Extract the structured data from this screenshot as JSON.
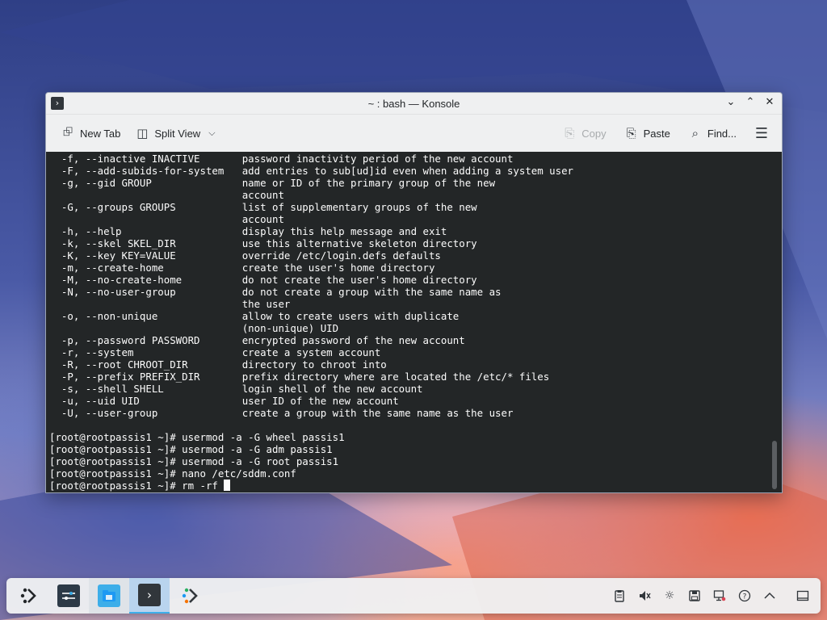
{
  "window": {
    "title": "~ : bash — Konsole",
    "controls": {
      "minimize_icon": "chevron-down-icon",
      "maximize_icon": "chevron-up-icon",
      "close_icon": "close-icon"
    }
  },
  "toolbar": {
    "new_tab": "New Tab",
    "split_view": "Split View",
    "copy": "Copy",
    "paste": "Paste",
    "find": "Find..."
  },
  "terminal": {
    "lines": [
      "  -f, --inactive INACTIVE       password inactivity period of the new account",
      "  -F, --add-subids-for-system   add entries to sub[ud]id even when adding a system user",
      "  -g, --gid GROUP               name or ID of the primary group of the new",
      "                                account",
      "  -G, --groups GROUPS           list of supplementary groups of the new",
      "                                account",
      "  -h, --help                    display this help message and exit",
      "  -k, --skel SKEL_DIR           use this alternative skeleton directory",
      "  -K, --key KEY=VALUE           override /etc/login.defs defaults",
      "  -m, --create-home             create the user's home directory",
      "  -M, --no-create-home          do not create the user's home directory",
      "  -N, --no-user-group           do not create a group with the same name as",
      "                                the user",
      "  -o, --non-unique              allow to create users with duplicate",
      "                                (non-unique) UID",
      "  -p, --password PASSWORD       encrypted password of the new account",
      "  -r, --system                  create a system account",
      "  -R, --root CHROOT_DIR         directory to chroot into",
      "  -P, --prefix PREFIX_DIR       prefix directory where are located the /etc/* files",
      "  -s, --shell SHELL             login shell of the new account",
      "  -u, --uid UID                 user ID of the new account",
      "  -U, --user-group              create a group with the same name as the user",
      "",
      "[root@rootpassis1 ~]# usermod -a -G wheel passis1",
      "[root@rootpassis1 ~]# usermod -a -G adm passis1",
      "[root@rootpassis1 ~]# usermod -a -G root passis1",
      "[root@rootpassis1 ~]# nano /etc/sddm.conf"
    ],
    "prompt_line": "[root@rootpassis1 ~]# rm -rf "
  },
  "taskbar": {
    "launchers": [
      "kde-application-launcher-icon",
      "system-settings-icon",
      "file-manager-icon",
      "konsole-icon",
      "discover-icon"
    ],
    "tray": [
      "clipboard-icon",
      "volume-muted-icon",
      "brightness-icon",
      "disk-icon",
      "network-icon",
      "help-icon",
      "expand-tray-icon",
      "show-desktop-icon"
    ]
  }
}
